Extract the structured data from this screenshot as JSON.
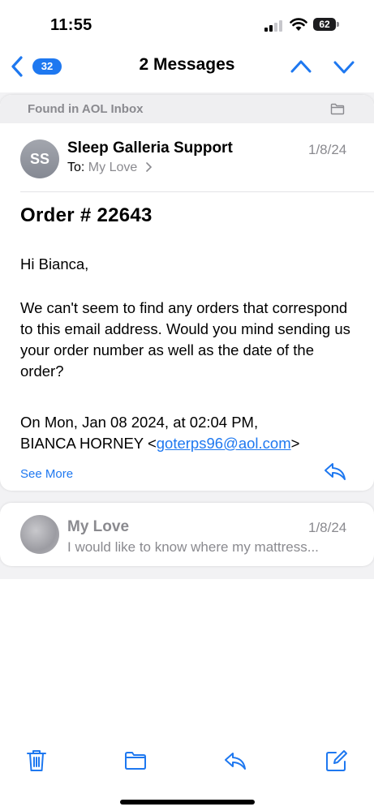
{
  "status_bar": {
    "time": "11:55",
    "battery": "62",
    "battery_level": 0.62
  },
  "nav": {
    "back_count": "32",
    "title": "2 Messages",
    "icons": [
      "chevron-left",
      "chevron-up",
      "chevron-down"
    ]
  },
  "colors": {
    "accent": "#1e78f0",
    "secondary_text": "#8a8a8f",
    "background": "#f2f2f4"
  },
  "thread": {
    "found_in": "Found in AOL Inbox",
    "message1": {
      "avatar_initials": "SS",
      "sender": "Sleep Galleria Support",
      "date": "1/8/24",
      "to_label": "To:",
      "to_name": "My Love",
      "subject": "Order # 22643",
      "greeting": "Hi Bianca,",
      "body": "We can't seem to find any orders that correspond to this email address. Would you mind sending us your order number as well as the date of the order?",
      "quote_header": "On Mon, Jan 08 2024, at 02:04 PM,",
      "quote_name": "BIANCA HORNEY <",
      "quote_email": "goterps96@aol.com",
      "quote_end": ">",
      "see_more": "See More"
    },
    "message2": {
      "sender": "My Love",
      "date": "1/8/24",
      "preview": "I would like to know where my mattress..."
    }
  },
  "toolbar": {
    "icons": [
      "trash",
      "folder",
      "reply",
      "compose"
    ]
  }
}
